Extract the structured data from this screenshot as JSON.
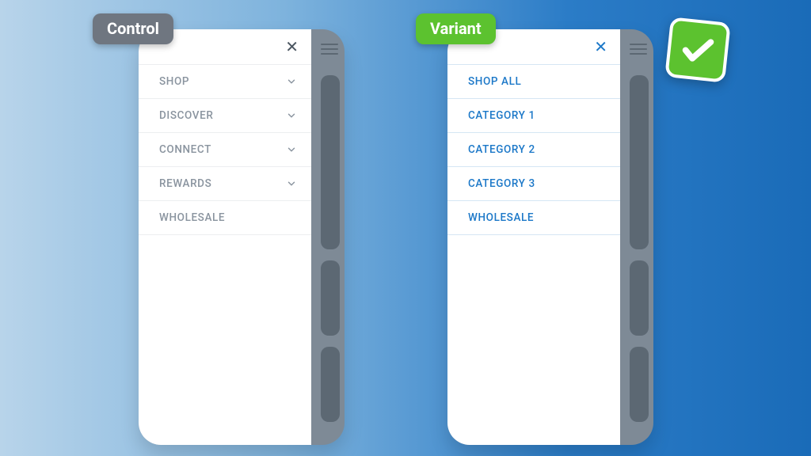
{
  "control": {
    "badge": "Control",
    "items": [
      {
        "label": "SHOP",
        "expandable": true
      },
      {
        "label": "DISCOVER",
        "expandable": true
      },
      {
        "label": "CONNECT",
        "expandable": true
      },
      {
        "label": "REWARDS",
        "expandable": true
      },
      {
        "label": "WHOLESALE",
        "expandable": false
      }
    ]
  },
  "variant": {
    "badge": "Variant",
    "items": [
      {
        "label": "SHOP ALL"
      },
      {
        "label": "CATEGORY 1"
      },
      {
        "label": "CATEGORY 2"
      },
      {
        "label": "CATEGORY 3"
      },
      {
        "label": "WHOLESALE"
      }
    ]
  },
  "colors": {
    "control_badge": "#6f7680",
    "variant_badge": "#5cc22f",
    "control_text": "#8a949f",
    "variant_text": "#1c78c8"
  },
  "winner": "variant"
}
